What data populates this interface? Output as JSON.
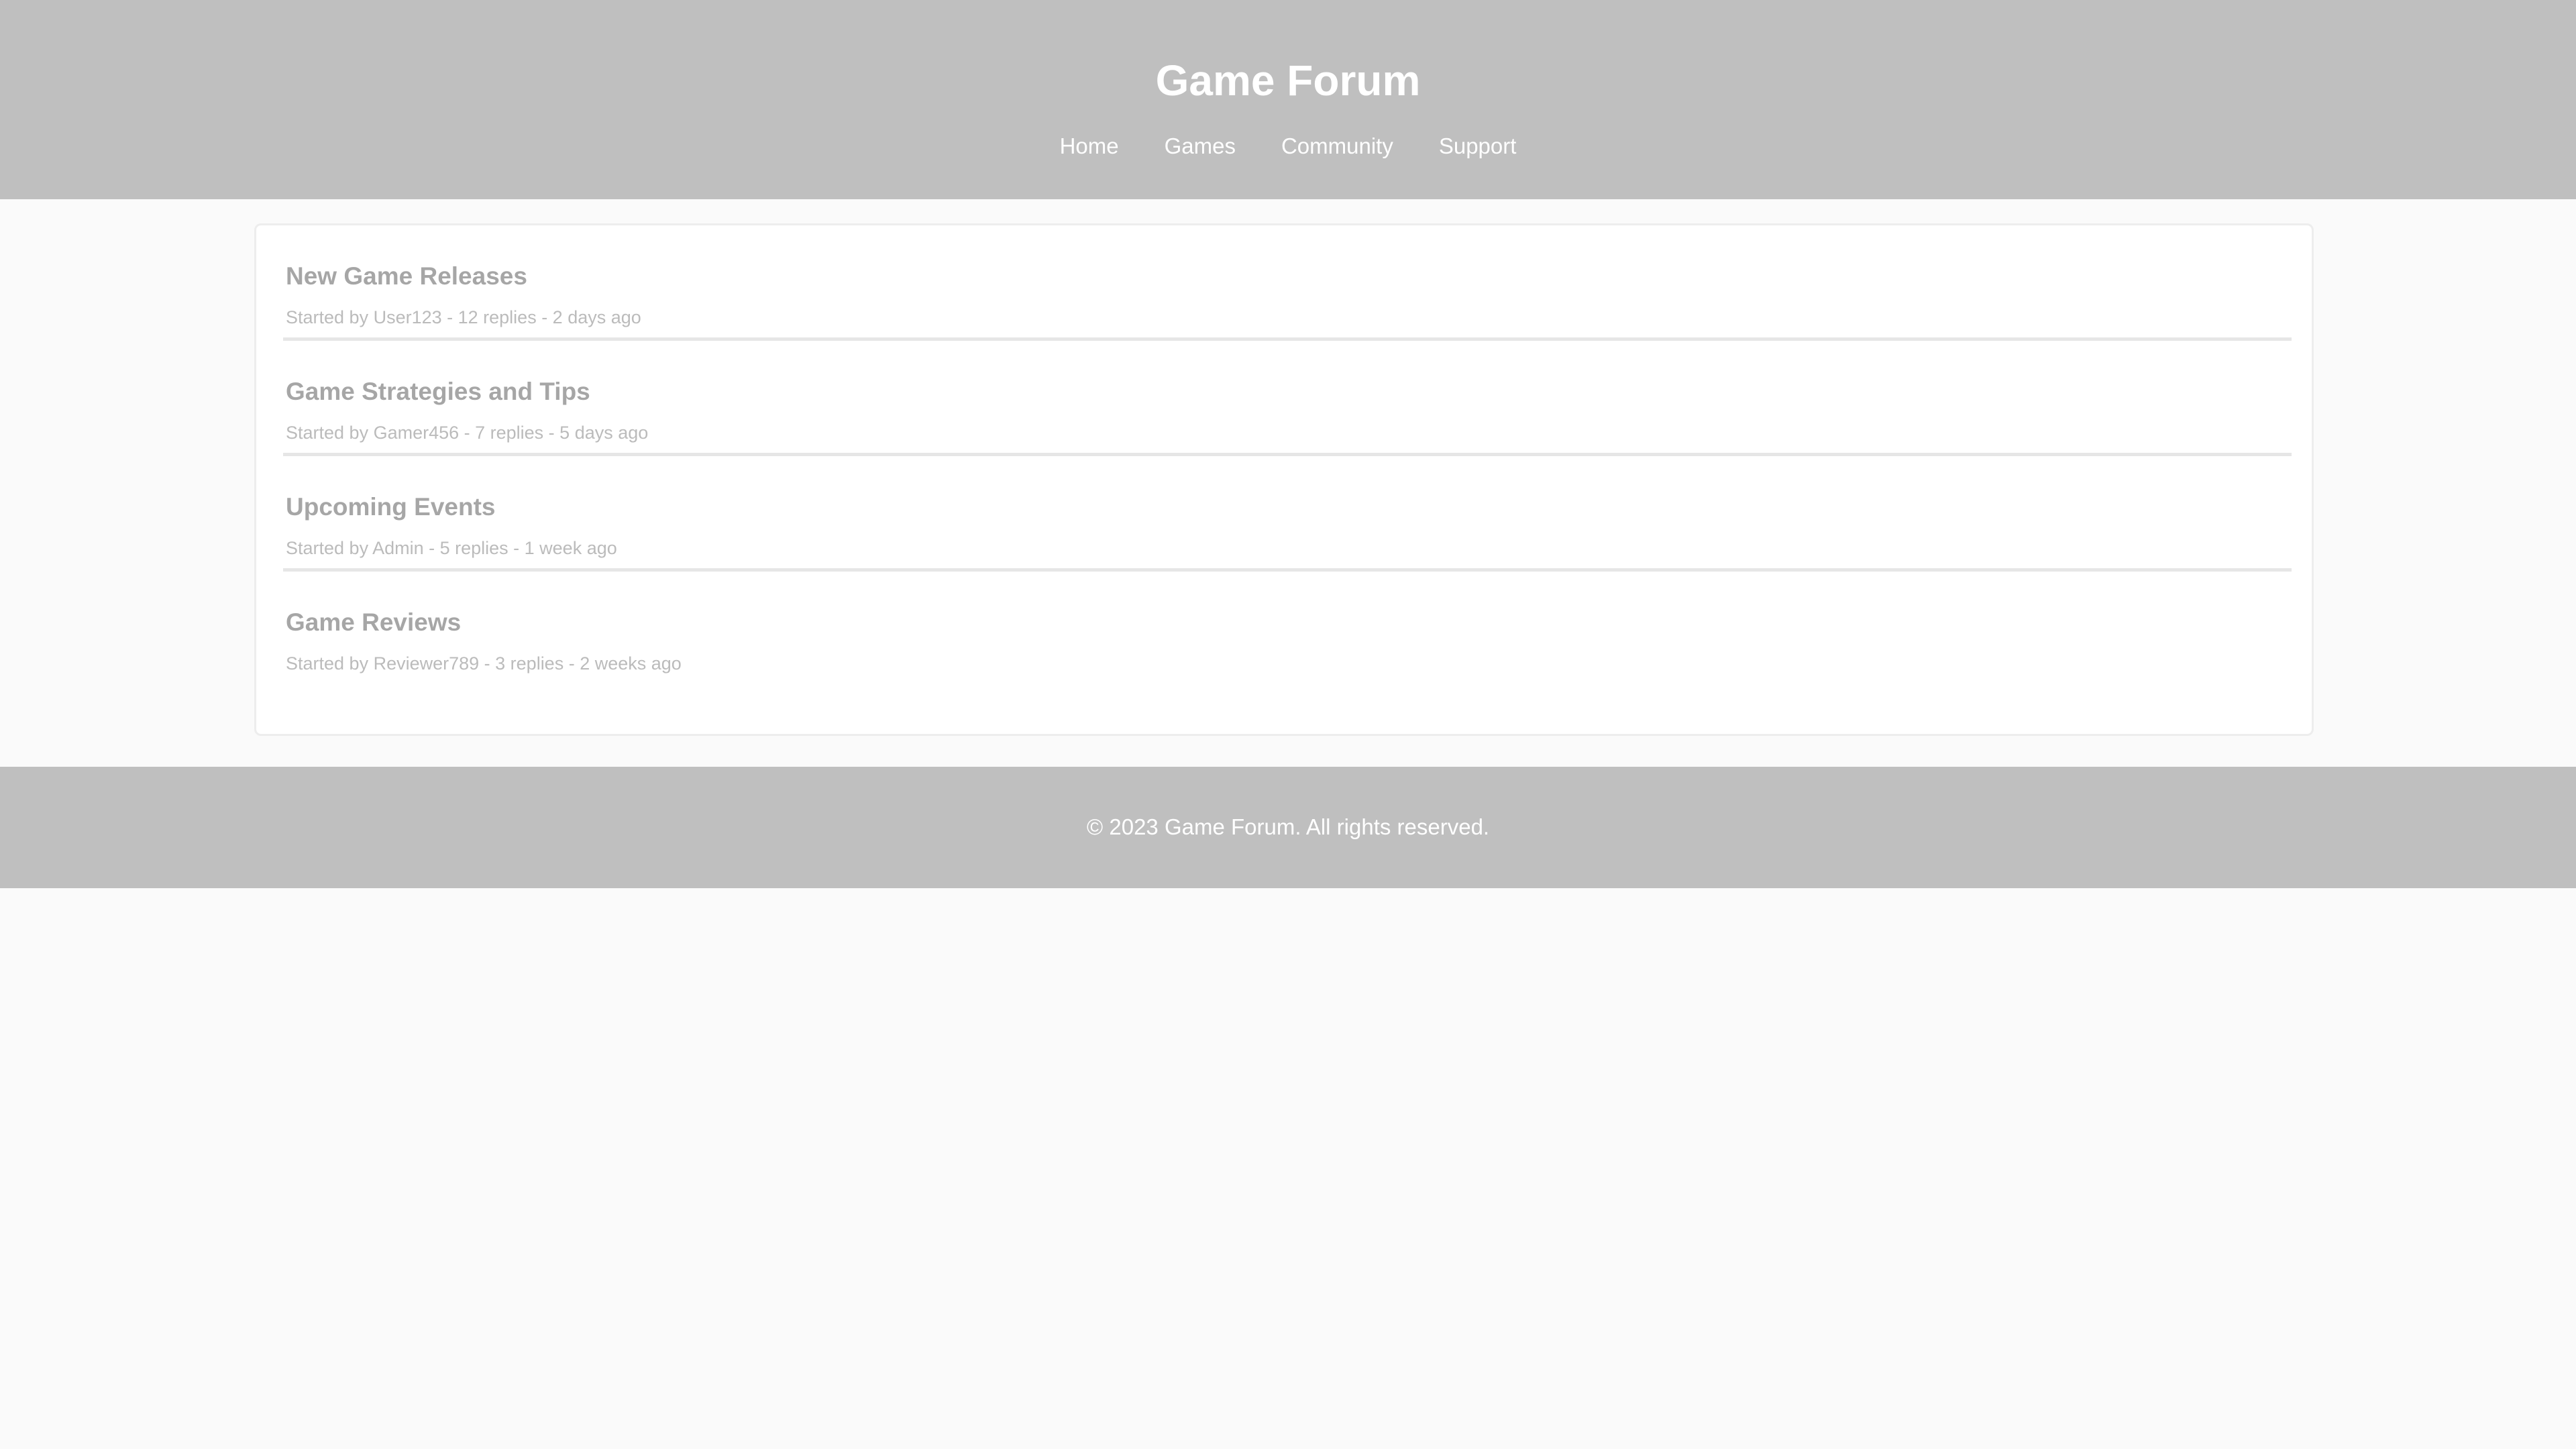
{
  "header": {
    "title": "Game Forum",
    "nav": [
      "Home",
      "Games",
      "Community",
      "Support"
    ]
  },
  "threads": [
    {
      "title": "New Game Releases",
      "meta": "Started by User123 - 12 replies - 2 days ago"
    },
    {
      "title": "Game Strategies and Tips",
      "meta": "Started by Gamer456 - 7 replies - 5 days ago"
    },
    {
      "title": "Upcoming Events",
      "meta": "Started by Admin - 5 replies - 1 week ago"
    },
    {
      "title": "Game Reviews",
      "meta": "Started by Reviewer789 - 3 replies - 2 weeks ago"
    }
  ],
  "footer": {
    "text": "© 2023 Game Forum. All rights reserved."
  },
  "colors": {
    "header_bg": "#bfbfbf",
    "page_bg": "#fafafa",
    "title_text": "#a6a6a6",
    "meta_text": "#bbbbbb"
  }
}
